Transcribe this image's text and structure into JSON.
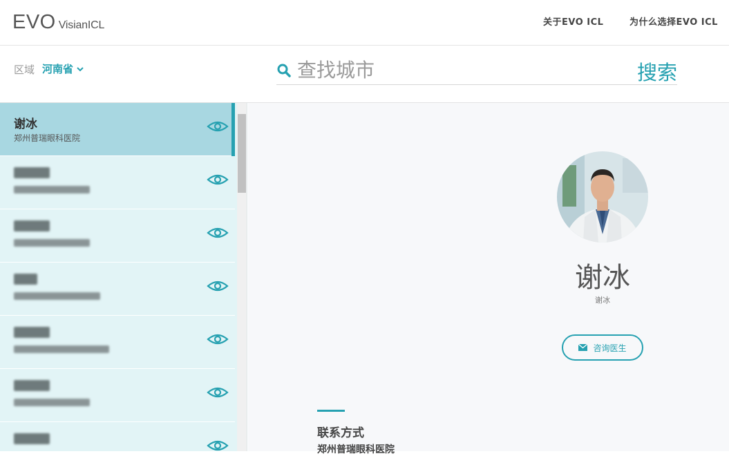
{
  "header": {
    "logo_evo": "EVO",
    "logo_visian": "VisianICL",
    "nav": [
      {
        "label": "关于EVO ICL"
      },
      {
        "label": "为什么选择EVO ICL"
      }
    ]
  },
  "filter": {
    "region_label": "区域",
    "region_value": "河南省",
    "search_placeholder": "查找城市",
    "search_button": "搜索"
  },
  "doctors": [
    {
      "name": "谢冰",
      "hospital": "郑州普瑞眼科医院",
      "active": true
    },
    {
      "name": "",
      "hospital": "",
      "active": false
    },
    {
      "name": "",
      "hospital": "",
      "active": false
    },
    {
      "name": "",
      "hospital": "",
      "active": false
    },
    {
      "name": "",
      "hospital": "",
      "active": false
    },
    {
      "name": "",
      "hospital": "",
      "active": false
    },
    {
      "name": "",
      "hospital": "",
      "active": false
    }
  ],
  "detail": {
    "name": "谢冰",
    "sub_name": "谢冰",
    "consult_button": "咨询医生",
    "contact_title": "联系方式",
    "contact_hospital": "郑州普瑞眼科医院"
  },
  "colors": {
    "accent": "#26a1b1",
    "list_bg": "#e2f4f6",
    "active_bg": "#a8d7e1"
  },
  "icons": [
    "search-icon",
    "chevron-down-icon",
    "eye-icon",
    "mail-icon"
  ]
}
